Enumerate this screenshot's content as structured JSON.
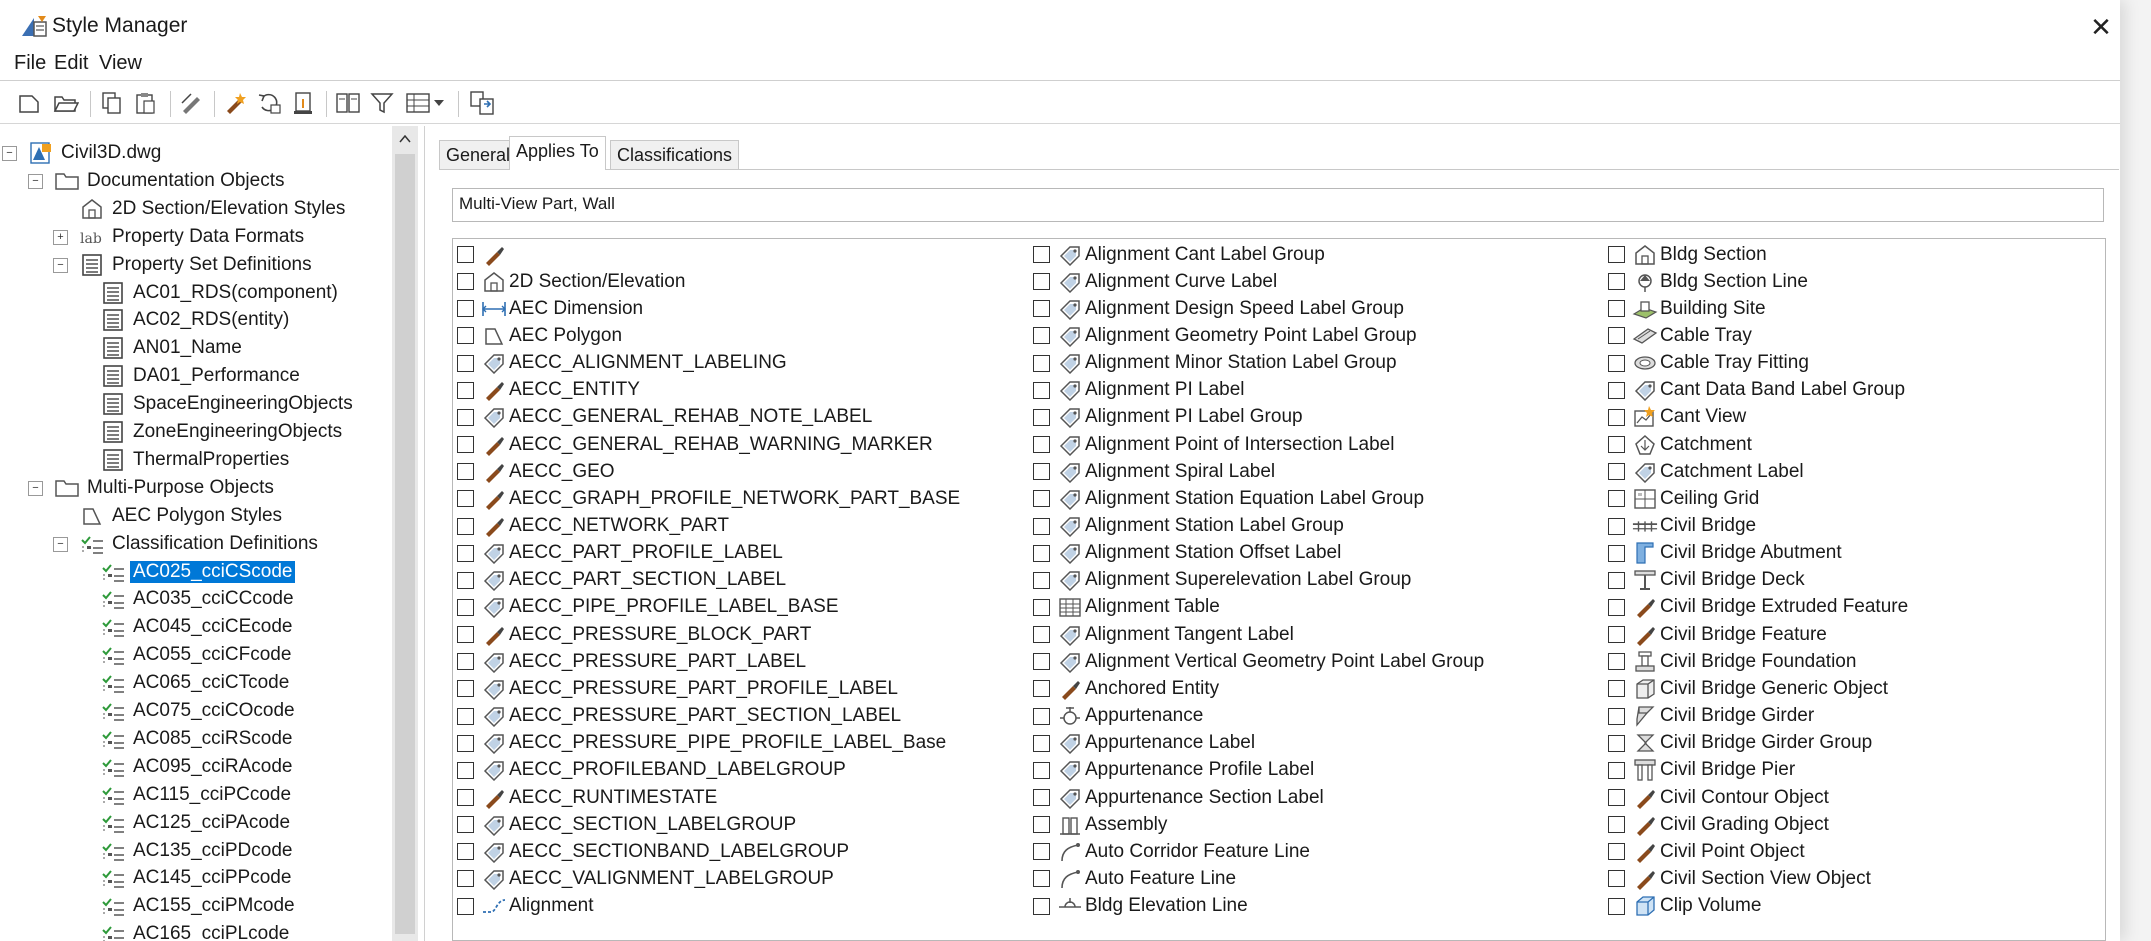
{
  "window": {
    "title": "Style Manager",
    "close_glyph": "✕"
  },
  "menu": [
    "File",
    "Edit",
    "View"
  ],
  "toolbar": [
    "new-drawing-icon",
    "open-drawing-icon",
    "copy-icon",
    "paste-icon",
    "edit-style-icon",
    "purge-styles-icon",
    "synchronize-icon",
    "update-standards-icon",
    "toggle-view-icon",
    "filter-icon",
    "view-options-icon",
    "dropdown-arrow-icon",
    "set-from-icon"
  ],
  "tree": [
    {
      "label": "Civil3D.dwg",
      "level": 0,
      "exp": "−",
      "icon": "drawing-icon"
    },
    {
      "label": "Documentation Objects",
      "level": 1,
      "exp": "−",
      "icon": "folder-icon"
    },
    {
      "label": "2D Section/Elevation Styles",
      "level": 2,
      "exp": "",
      "icon": "section-elevation-icon"
    },
    {
      "label": "Property Data Formats",
      "level": 2,
      "exp": "+",
      "icon": "property-format-icon",
      "prefix": "lab"
    },
    {
      "label": "Property Set Definitions",
      "level": 2,
      "exp": "−",
      "icon": "property-set-icon"
    },
    {
      "label": "AC01_RDS(component)",
      "level": 3,
      "exp": "",
      "icon": "property-set-icon"
    },
    {
      "label": "AC02_RDS(entity)",
      "level": 3,
      "exp": "",
      "icon": "property-set-icon"
    },
    {
      "label": "AN01_Name",
      "level": 3,
      "exp": "",
      "icon": "property-set-icon"
    },
    {
      "label": "DA01_Performance",
      "level": 3,
      "exp": "",
      "icon": "property-set-icon"
    },
    {
      "label": "SpaceEngineeringObjects",
      "level": 3,
      "exp": "",
      "icon": "property-set-icon"
    },
    {
      "label": "ZoneEngineeringObjects",
      "level": 3,
      "exp": "",
      "icon": "property-set-icon"
    },
    {
      "label": "ThermalProperties",
      "level": 3,
      "exp": "",
      "icon": "property-set-icon"
    },
    {
      "label": "Multi-Purpose Objects",
      "level": 1,
      "exp": "−",
      "icon": "folder-icon"
    },
    {
      "label": "AEC Polygon Styles",
      "level": 2,
      "exp": "",
      "icon": "polygon-icon"
    },
    {
      "label": "Classification Definitions",
      "level": 2,
      "exp": "−",
      "icon": "classification-icon"
    },
    {
      "label": "AC025_cciCScode",
      "level": 3,
      "exp": "",
      "icon": "classification-icon",
      "selected": true
    },
    {
      "label": "AC035_cciCCcode",
      "level": 3,
      "exp": "",
      "icon": "classification-icon"
    },
    {
      "label": "AC045_cciCEcode",
      "level": 3,
      "exp": "",
      "icon": "classification-icon"
    },
    {
      "label": "AC055_cciCFcode",
      "level": 3,
      "exp": "",
      "icon": "classification-icon"
    },
    {
      "label": "AC065_cciCTcode",
      "level": 3,
      "exp": "",
      "icon": "classification-icon"
    },
    {
      "label": "AC075_cciCOcode",
      "level": 3,
      "exp": "",
      "icon": "classification-icon"
    },
    {
      "label": "AC085_cciRScode",
      "level": 3,
      "exp": "",
      "icon": "classification-icon"
    },
    {
      "label": "AC095_cciRAcode",
      "level": 3,
      "exp": "",
      "icon": "classification-icon"
    },
    {
      "label": "AC115_cciPCcode",
      "level": 3,
      "exp": "",
      "icon": "classification-icon"
    },
    {
      "label": "AC125_cciPAcode",
      "level": 3,
      "exp": "",
      "icon": "classification-icon"
    },
    {
      "label": "AC135_cciPDcode",
      "level": 3,
      "exp": "",
      "icon": "classification-icon"
    },
    {
      "label": "AC145_cciPPcode",
      "level": 3,
      "exp": "",
      "icon": "classification-icon"
    },
    {
      "label": "AC155_cciPMcode",
      "level": 3,
      "exp": "",
      "icon": "classification-icon"
    },
    {
      "label": "AC165_cciPLcode",
      "level": 3,
      "exp": "",
      "icon": "classification-icon"
    }
  ],
  "tabs": [
    {
      "label": "General",
      "active": false
    },
    {
      "label": "Applies To",
      "active": true
    },
    {
      "label": "Classifications",
      "active": false
    }
  ],
  "applies_to_value": "Multi-View Part, Wall",
  "object_columns": [
    [
      {
        "label": "",
        "icon": "brush-icon"
      },
      {
        "label": "2D Section/Elevation",
        "icon": "section-elevation-icon"
      },
      {
        "label": "AEC Dimension",
        "icon": "dimension-icon"
      },
      {
        "label": "AEC Polygon",
        "icon": "polygon-icon"
      },
      {
        "label": "AECC_ALIGNMENT_LABELING",
        "icon": "label-tag-icon"
      },
      {
        "label": "AECC_ENTITY",
        "icon": "brush-icon"
      },
      {
        "label": "AECC_GENERAL_REHAB_NOTE_LABEL",
        "icon": "label-tag-icon"
      },
      {
        "label": "AECC_GENERAL_REHAB_WARNING_MARKER",
        "icon": "brush-icon"
      },
      {
        "label": "AECC_GEO",
        "icon": "brush-icon"
      },
      {
        "label": "AECC_GRAPH_PROFILE_NETWORK_PART_BASE",
        "icon": "brush-icon"
      },
      {
        "label": "AECC_NETWORK_PART",
        "icon": "brush-icon"
      },
      {
        "label": "AECC_PART_PROFILE_LABEL",
        "icon": "label-tag-icon"
      },
      {
        "label": "AECC_PART_SECTION_LABEL",
        "icon": "label-tag-icon"
      },
      {
        "label": "AECC_PIPE_PROFILE_LABEL_BASE",
        "icon": "label-tag-icon"
      },
      {
        "label": "AECC_PRESSURE_BLOCK_PART",
        "icon": "brush-icon"
      },
      {
        "label": "AECC_PRESSURE_PART_LABEL",
        "icon": "label-tag-icon"
      },
      {
        "label": "AECC_PRESSURE_PART_PROFILE_LABEL",
        "icon": "label-tag-icon"
      },
      {
        "label": "AECC_PRESSURE_PART_SECTION_LABEL",
        "icon": "label-tag-icon"
      },
      {
        "label": "AECC_PRESSURE_PIPE_PROFILE_LABEL_Base",
        "icon": "label-tag-icon"
      },
      {
        "label": "AECC_PROFILEBAND_LABELGROUP",
        "icon": "label-tag-icon"
      },
      {
        "label": "AECC_RUNTIMESTATE",
        "icon": "brush-icon"
      },
      {
        "label": "AECC_SECTION_LABELGROUP",
        "icon": "label-tag-icon"
      },
      {
        "label": "AECC_SECTIONBAND_LABELGROUP",
        "icon": "label-tag-icon"
      },
      {
        "label": "AECC_VALIGNMENT_LABELGROUP",
        "icon": "label-tag-icon"
      },
      {
        "label": "Alignment",
        "icon": "alignment-icon"
      }
    ],
    [
      {
        "label": "Alignment Cant Label Group",
        "icon": "label-tag-icon"
      },
      {
        "label": "Alignment Curve Label",
        "icon": "label-tag-icon"
      },
      {
        "label": "Alignment Design Speed Label Group",
        "icon": "label-tag-icon"
      },
      {
        "label": "Alignment Geometry Point Label Group",
        "icon": "label-tag-icon"
      },
      {
        "label": "Alignment Minor Station Label Group",
        "icon": "label-tag-icon"
      },
      {
        "label": "Alignment PI Label",
        "icon": "label-tag-icon"
      },
      {
        "label": "Alignment PI Label Group",
        "icon": "label-tag-icon"
      },
      {
        "label": "Alignment Point of Intersection Label",
        "icon": "label-tag-icon"
      },
      {
        "label": "Alignment Spiral Label",
        "icon": "label-tag-icon"
      },
      {
        "label": "Alignment Station Equation Label Group",
        "icon": "label-tag-icon"
      },
      {
        "label": "Alignment Station Label Group",
        "icon": "label-tag-icon"
      },
      {
        "label": "Alignment Station Offset Label",
        "icon": "label-tag-icon"
      },
      {
        "label": "Alignment Superelevation Label Group",
        "icon": "label-tag-icon"
      },
      {
        "label": "Alignment Table",
        "icon": "table-icon"
      },
      {
        "label": "Alignment Tangent Label",
        "icon": "label-tag-icon"
      },
      {
        "label": "Alignment Vertical Geometry Point Label Group",
        "icon": "label-tag-icon"
      },
      {
        "label": "Anchored Entity",
        "icon": "brush-icon"
      },
      {
        "label": "Appurtenance",
        "icon": "appurtenance-icon"
      },
      {
        "label": "Appurtenance Label",
        "icon": "label-tag-icon"
      },
      {
        "label": "Appurtenance Profile Label",
        "icon": "label-tag-icon"
      },
      {
        "label": "Appurtenance Section Label",
        "icon": "label-tag-icon"
      },
      {
        "label": "Assembly",
        "icon": "assembly-icon"
      },
      {
        "label": "Auto Corridor Feature Line",
        "icon": "feature-line-icon"
      },
      {
        "label": "Auto Feature Line",
        "icon": "feature-line-icon"
      },
      {
        "label": "Bldg Elevation Line",
        "icon": "elevation-line-icon"
      }
    ],
    [
      {
        "label": "Bldg Section",
        "icon": "section-elevation-icon"
      },
      {
        "label": "Bldg Section Line",
        "icon": "section-line-icon"
      },
      {
        "label": "Building Site",
        "icon": "building-site-icon"
      },
      {
        "label": "Cable Tray",
        "icon": "cable-tray-icon"
      },
      {
        "label": "Cable Tray Fitting",
        "icon": "cable-tray-fitting-icon"
      },
      {
        "label": "Cant Data Band Label Group",
        "icon": "label-tag-icon"
      },
      {
        "label": "Cant View",
        "icon": "cant-view-icon"
      },
      {
        "label": "Catchment",
        "icon": "catchment-icon"
      },
      {
        "label": "Catchment Label",
        "icon": "label-tag-icon"
      },
      {
        "label": "Ceiling Grid",
        "icon": "ceiling-grid-icon"
      },
      {
        "label": "Civil Bridge",
        "icon": "bridge-icon"
      },
      {
        "label": "Civil Bridge Abutment",
        "icon": "abutment-icon"
      },
      {
        "label": "Civil Bridge Deck",
        "icon": "deck-icon"
      },
      {
        "label": "Civil Bridge Extruded Feature",
        "icon": "brush-icon"
      },
      {
        "label": "Civil Bridge Feature",
        "icon": "brush-icon"
      },
      {
        "label": "Civil Bridge Foundation",
        "icon": "foundation-icon"
      },
      {
        "label": "Civil Bridge Generic Object",
        "icon": "generic-object-icon"
      },
      {
        "label": "Civil Bridge Girder",
        "icon": "girder-icon"
      },
      {
        "label": "Civil Bridge Girder Group",
        "icon": "girder-group-icon"
      },
      {
        "label": "Civil Bridge Pier",
        "icon": "pier-icon"
      },
      {
        "label": "Civil Contour Object",
        "icon": "brush-icon"
      },
      {
        "label": "Civil Grading Object",
        "icon": "brush-icon"
      },
      {
        "label": "Civil Point Object",
        "icon": "brush-icon"
      },
      {
        "label": "Civil Section View Object",
        "icon": "brush-icon"
      },
      {
        "label": "Clip Volume",
        "icon": "clip-volume-icon"
      }
    ]
  ],
  "colors": {
    "selection": "#0078d7",
    "brush": "#8a4a1c",
    "tag": "#4a7fb5",
    "check": "#2e9a3a"
  }
}
